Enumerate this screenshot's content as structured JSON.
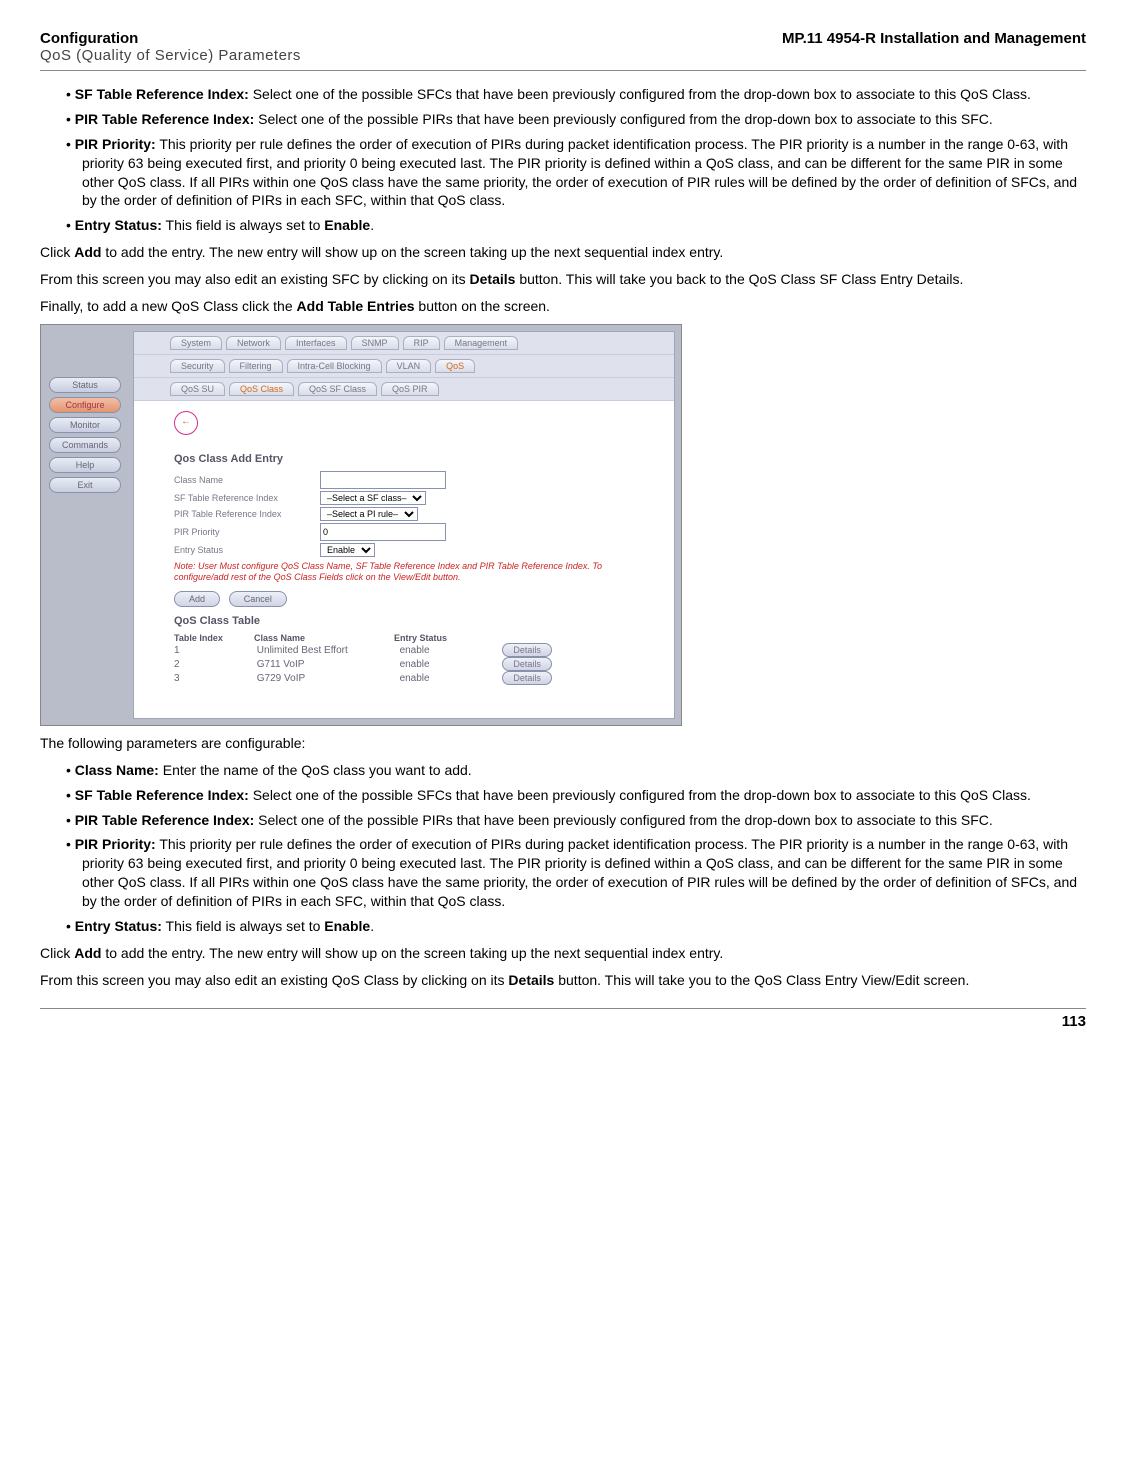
{
  "header": {
    "title": "Configuration",
    "subtitle": "QoS (Quality of Service) Parameters",
    "right": "MP.11 4954-R Installation and Management"
  },
  "bullets1": [
    {
      "term": "SF Table Reference Index:",
      "text": " Select one of the possible SFCs that have been previously configured from the drop-down box to associate to this QoS Class."
    },
    {
      "term": "PIR Table Reference Index:",
      "text": " Select one of the possible PIRs that have been previously configured from the drop-down box to associate to this SFC."
    },
    {
      "term": "PIR Priority:",
      "text": " This priority per rule defines the order of execution of PIRs during packet identification process. The PIR priority is a number in the range 0-63, with priority 63 being executed first, and priority 0 being executed last. The PIR priority is defined within a QoS class, and can be different for the same PIR in some other QoS class. If all PIRs within one QoS class have the same priority, the order of execution of PIR rules will be defined by the order of definition of SFCs, and by the order of definition of PIRs in each SFC, within that QoS class."
    },
    {
      "term": "Entry Status:",
      "text": " This field is always set to ",
      "term2": "Enable",
      "tail": "."
    }
  ],
  "para1": {
    "pre": "Click ",
    "b1": "Add",
    "mid": " to add the entry. The new entry will show up on the screen taking up the next sequential index entry."
  },
  "para2": {
    "pre": "From this screen you may also edit an existing SFC by clicking on its ",
    "b1": "Details",
    "mid": " button. This will take you back to the QoS Class SF Class Entry Details."
  },
  "para3": {
    "pre": "Finally, to add a new QoS Class click the ",
    "b1": "Add Table Entries",
    "mid": " button on the screen."
  },
  "figure": {
    "tabs1": [
      "System",
      "Network",
      "Interfaces",
      "SNMP",
      "RIP",
      "Management"
    ],
    "tabs2": [
      "Security",
      "Filtering",
      "Intra-Cell Blocking",
      "VLAN",
      "QoS"
    ],
    "active_tab2": "QoS",
    "tabs3": [
      "QoS SU",
      "QoS Class",
      "QoS SF Class",
      "QoS PIR"
    ],
    "active_tab3": "QoS Class",
    "sidebar": [
      "Status",
      "Configure",
      "Monitor",
      "Commands",
      "Help",
      "Exit"
    ],
    "active_side": "Configure",
    "back": "←",
    "section1": "Qos Class Add Entry",
    "form": {
      "class_name_label": "Class Name",
      "class_name_value": "",
      "sf_label": "SF Table Reference Index",
      "sf_value": "–Select a SF class–",
      "pir_label": "PIR Table Reference Index",
      "pir_value": "–Select a PI rule–",
      "priority_label": "PIR Priority",
      "priority_value": "0",
      "status_label": "Entry Status",
      "status_value": "Enable",
      "note": "Note: User Must configure QoS Class Name, SF Table Reference Index and PIR Table Reference Index. To configure/add rest of the QoS Class Fields click on the View/Edit button.",
      "add": "Add",
      "cancel": "Cancel"
    },
    "section2": "QoS Class Table",
    "table": {
      "headers": [
        "Table Index",
        "Class Name",
        "Entry Status",
        ""
      ],
      "rows": [
        {
          "index": "1",
          "name": "Unlimited Best Effort",
          "status": "enable",
          "btn": "Details"
        },
        {
          "index": "2",
          "name": "G711 VoIP",
          "status": "enable",
          "btn": "Details"
        },
        {
          "index": "3",
          "name": "G729 VoIP",
          "status": "enable",
          "btn": "Details"
        }
      ]
    }
  },
  "para4": "The following parameters are configurable:",
  "bullets2": [
    {
      "term": "Class Name:",
      "text": " Enter the name of the QoS class you want to add."
    },
    {
      "term": "SF Table Reference Index:",
      "text": " Select one of the possible SFCs that have been previously configured from the drop-down box to associate to this QoS Class."
    },
    {
      "term": "PIR Table Reference Index:",
      "text": " Select one of the possible PIRs that have been previously configured from the drop-down box to associate to this SFC."
    },
    {
      "term": "PIR Priority:",
      "text": " This priority per rule defines the order of execution of PIRs during packet identification process. The PIR priority is a number in the range 0-63, with priority 63 being executed first, and priority 0 being executed last. The PIR priority is defined within a QoS class, and can be different for the same PIR in some other QoS class. If all PIRs within one QoS class have the same priority, the order of execution of PIR rules will be defined by the order of definition of SFCs, and by the order of definition of PIRs in each SFC, within that QoS class."
    },
    {
      "term": "Entry Status:",
      "text": " This field is always set to ",
      "term2": "Enable",
      "tail": "."
    }
  ],
  "para5": {
    "pre": "Click ",
    "b1": "Add",
    "mid": " to add the entry. The new entry will show up on the screen taking up the next sequential index entry."
  },
  "para6": {
    "pre": "From this screen you may also edit an existing QoS Class by clicking on its ",
    "b1": "Details",
    "mid": " button. This will take you to the QoS Class Entry View/Edit screen."
  },
  "footer": {
    "page": "113"
  }
}
